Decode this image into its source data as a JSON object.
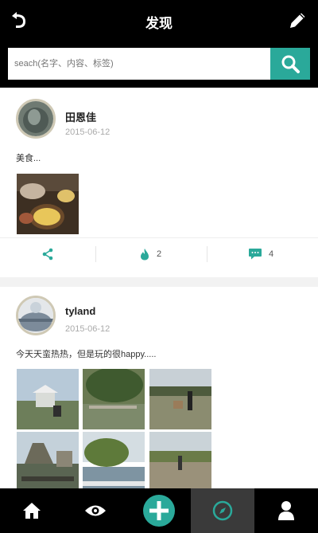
{
  "header": {
    "title": "发现"
  },
  "search": {
    "placeholder": "seach(名字、内容、标签)"
  },
  "posts": [
    {
      "author": "田恩佳",
      "date": "2015-06-12",
      "content": "美食...",
      "shares": "",
      "likes": "2",
      "comments": "4"
    },
    {
      "author": "tyland",
      "date": "2015-06-12",
      "content": "今天天蛮热热，但是玩的很happy....."
    }
  ],
  "colors": {
    "accent": "#2aa99a",
    "bar": "#000000",
    "active_tab": "#3a3a3a"
  },
  "nav": [
    "home-icon",
    "eye-icon",
    "add-icon",
    "compass-icon",
    "user-icon"
  ]
}
